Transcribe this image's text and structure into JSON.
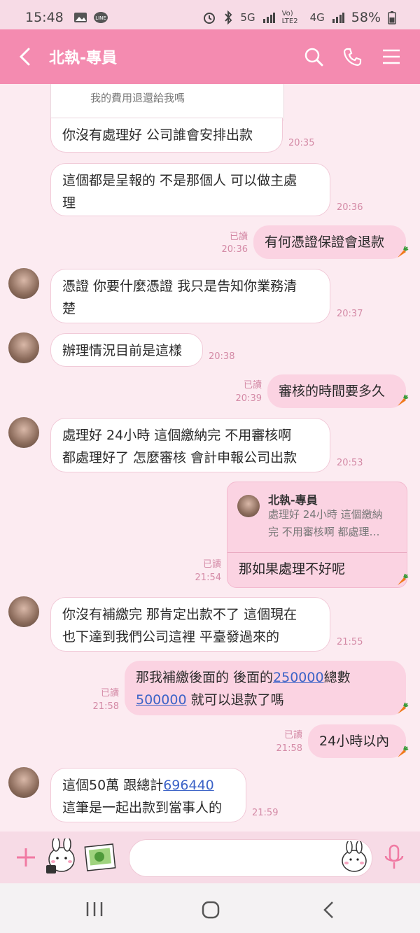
{
  "status_bar": {
    "time": "15:48",
    "network_5g": "5G",
    "volte": "Vo) LTE2",
    "network_4g": "4G",
    "battery": "58%"
  },
  "header": {
    "title": "北執-專員"
  },
  "messages": {
    "partial_quote_text": "我的費用退還給我嗎",
    "m1": {
      "line1": "你沒有處理好 公司誰會安排出款",
      "time": "20:35"
    },
    "m2": {
      "line1": "這個都是呈報的 不是那個人 可以做主處",
      "line2": "理",
      "time": "20:36"
    },
    "m3": {
      "read": "已讀",
      "time": "20:36",
      "text": "有何憑證保證會退款"
    },
    "m4": {
      "line1": "憑證 你要什麼憑證 我只是告知你業務清",
      "line2": "楚",
      "time": "20:37"
    },
    "m5": {
      "text": "辦理情況目前是這樣",
      "time": "20:38"
    },
    "m6": {
      "read": "已讀",
      "time": "20:39",
      "text": "審核的時間要多久"
    },
    "m7": {
      "line1": "處理好 24小時 這個繳納完 不用審核啊",
      "line2": "都處理好了 怎麼審核  會計申報公司出款",
      "time": "20:53"
    },
    "m8": {
      "quote_name": "北執-專員",
      "quote_line1": "處理好 24小時 這個繳納",
      "quote_line2": "完 不用審核啊 都處理…",
      "text": "那如果處理不好呢",
      "read": "已讀",
      "time": "21:54"
    },
    "m9": {
      "line1": "你沒有補繳完 那肯定出款不了 這個現在",
      "line2": "也下達到我們公司這裡 平臺發過來的",
      "time": "21:55"
    },
    "m10": {
      "part1": "那我補繳後面的 後面的",
      "link1": "250000",
      "part2": "總數",
      "link2": "500000",
      "part3": " 就可以退款了嗎",
      "read": "已讀",
      "time": "21:58"
    },
    "m11": {
      "read": "已讀",
      "time": "21:58",
      "text": "24小時以內"
    },
    "m12": {
      "part1": "這個50萬 跟總計",
      "link1": "696440",
      "line2": "這筆是一起出款到當事人的",
      "time": "21:59"
    }
  },
  "colors": {
    "header": "#f48bb0",
    "background": "#fcebf1",
    "outgoing": "#fbd3e2",
    "link": "#3c63c7"
  },
  "icons": [
    "back-icon",
    "search-icon",
    "phone-icon",
    "menu-icon",
    "plus-icon",
    "sticker-icon",
    "photo-icon",
    "emoji-icon",
    "mic-icon",
    "carrot-icon"
  ]
}
